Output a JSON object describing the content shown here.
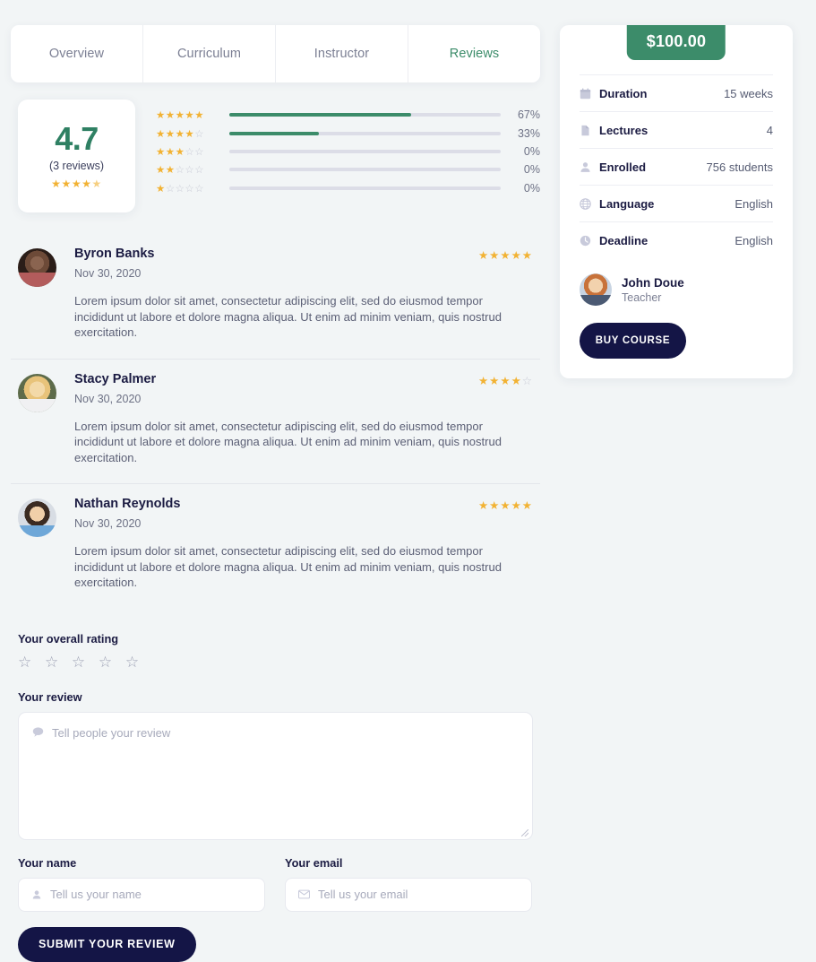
{
  "tabs": [
    {
      "label": "Overview",
      "active": false
    },
    {
      "label": "Curriculum",
      "active": false
    },
    {
      "label": "Instructor",
      "active": false
    },
    {
      "label": "Reviews",
      "active": true
    }
  ],
  "rating_summary": {
    "score": "4.7",
    "reviews_count_label": "(3 reviews)",
    "score_stars": "★★★★⯪",
    "distribution": [
      {
        "stars": 5,
        "stars_glyphs": "★★★★★",
        "percent_label": "67%",
        "percent": 67
      },
      {
        "stars": 4,
        "stars_glyphs": "★★★★☆",
        "percent_label": "33%",
        "percent": 33
      },
      {
        "stars": 3,
        "stars_glyphs": "★★★☆☆",
        "percent_label": "0%",
        "percent": 0
      },
      {
        "stars": 2,
        "stars_glyphs": "★★☆☆☆",
        "percent_label": "0%",
        "percent": 0
      },
      {
        "stars": 1,
        "stars_glyphs": "★☆☆☆☆",
        "percent_label": "0%",
        "percent": 0
      }
    ]
  },
  "reviews": [
    {
      "name": "Byron Banks",
      "date": "Nov 30, 2020",
      "stars": 5,
      "stars_glyphs": "★★★★★",
      "text": "Lorem ipsum dolor sit amet, consectetur adipiscing elit, sed do eiusmod tempor incididunt ut labore et dolore magna aliqua. Ut enim ad minim veniam, quis nostrud exercitation."
    },
    {
      "name": "Stacy Palmer",
      "date": "Nov 30, 2020",
      "stars": 4,
      "stars_glyphs": "★★★★☆",
      "text": "Lorem ipsum dolor sit amet, consectetur adipiscing elit, sed do eiusmod tempor incididunt ut labore et dolore magna aliqua. Ut enim ad minim veniam, quis nostrud exercitation."
    },
    {
      "name": "Nathan Reynolds",
      "date": "Nov 30, 2020",
      "stars": 5,
      "stars_glyphs": "★★★★★",
      "text": "Lorem ipsum dolor sit amet, consectetur adipiscing elit, sed do eiusmod tempor incididunt ut labore et dolore magna aliqua. Ut enim ad minim veniam, quis nostrud exercitation."
    }
  ],
  "review_form": {
    "rating_label": "Your overall rating",
    "rating_stars": "☆ ☆ ☆ ☆ ☆",
    "review_label": "Your review",
    "review_placeholder": "Tell people your review",
    "name_label": "Your name",
    "name_placeholder": "Tell us your name",
    "email_label": "Your email",
    "email_placeholder": "Tell us your email",
    "submit_label": "SUBMIT YOUR REVIEW"
  },
  "sidebar": {
    "price": "$100.00",
    "meta": [
      {
        "icon": "calendar-icon",
        "label": "Duration",
        "value": "15 weeks"
      },
      {
        "icon": "file-icon",
        "label": "Lectures",
        "value": "4"
      },
      {
        "icon": "user-icon",
        "label": "Enrolled",
        "value": "756 students"
      },
      {
        "icon": "globe-icon",
        "label": "Language",
        "value": "English"
      },
      {
        "icon": "clock-icon",
        "label": "Deadline",
        "value": "English"
      }
    ],
    "teacher_name": "John Doue",
    "teacher_role": "Teacher",
    "buy_label": "BUY COURSE"
  },
  "colors": {
    "accent_green": "#3c8c6a",
    "star_gold": "#f2b233",
    "dark_navy": "#141546",
    "page_bg": "#f2f5f6"
  }
}
